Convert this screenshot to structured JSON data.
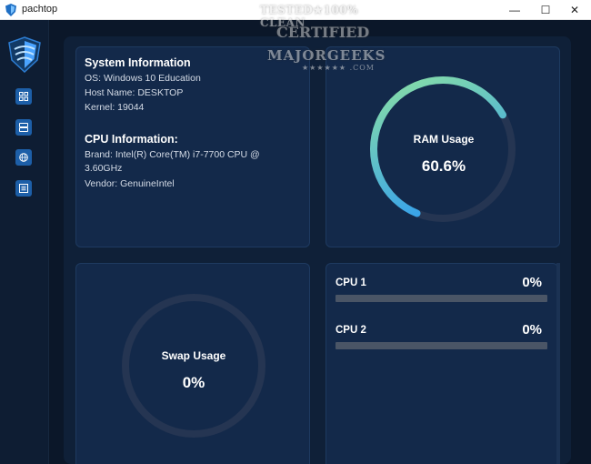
{
  "window": {
    "title": "pachtop",
    "minimize_glyph": "—",
    "maximize_glyph": "☐",
    "close_glyph": "✕"
  },
  "watermark": {
    "line1": "TESTED★100% CLEAN",
    "line2": "CERTIFIED",
    "line3": "MAJORGEEKS",
    "line4": "★★★★★★ .COM"
  },
  "sidebar": {
    "items": [
      {
        "name": "dashboard",
        "icon": "grid-icon"
      },
      {
        "name": "storage",
        "icon": "server-icon"
      },
      {
        "name": "network",
        "icon": "globe-icon"
      },
      {
        "name": "processes",
        "icon": "list-icon"
      }
    ]
  },
  "system_info": {
    "title": "System Information",
    "os": "OS: Windows 10 Education",
    "host": "Host Name: DESKTOP",
    "kernel": "Kernel: 19044"
  },
  "cpu_info": {
    "title": "CPU Information:",
    "brand_line1": "Brand: Intel(R) Core(TM) i7-7700 CPU @",
    "brand_line2": "3.60GHz",
    "vendor": "Vendor: GenuineIntel"
  },
  "ram": {
    "label": "RAM Usage",
    "value_text": "60.6%",
    "percent": 60.6
  },
  "swap": {
    "label": "Swap Usage",
    "value_text": "0%",
    "percent": 0
  },
  "cpus": [
    {
      "label": "CPU 1",
      "value_text": "0%",
      "percent": 0
    },
    {
      "label": "CPU 2",
      "value_text": "0%",
      "percent": 0
    }
  ],
  "colors": {
    "background": "#0b1729",
    "card": "#13294a",
    "gauge_start": "#8fe3a0",
    "gauge_end": "#1e8fff",
    "track": "#253552"
  }
}
